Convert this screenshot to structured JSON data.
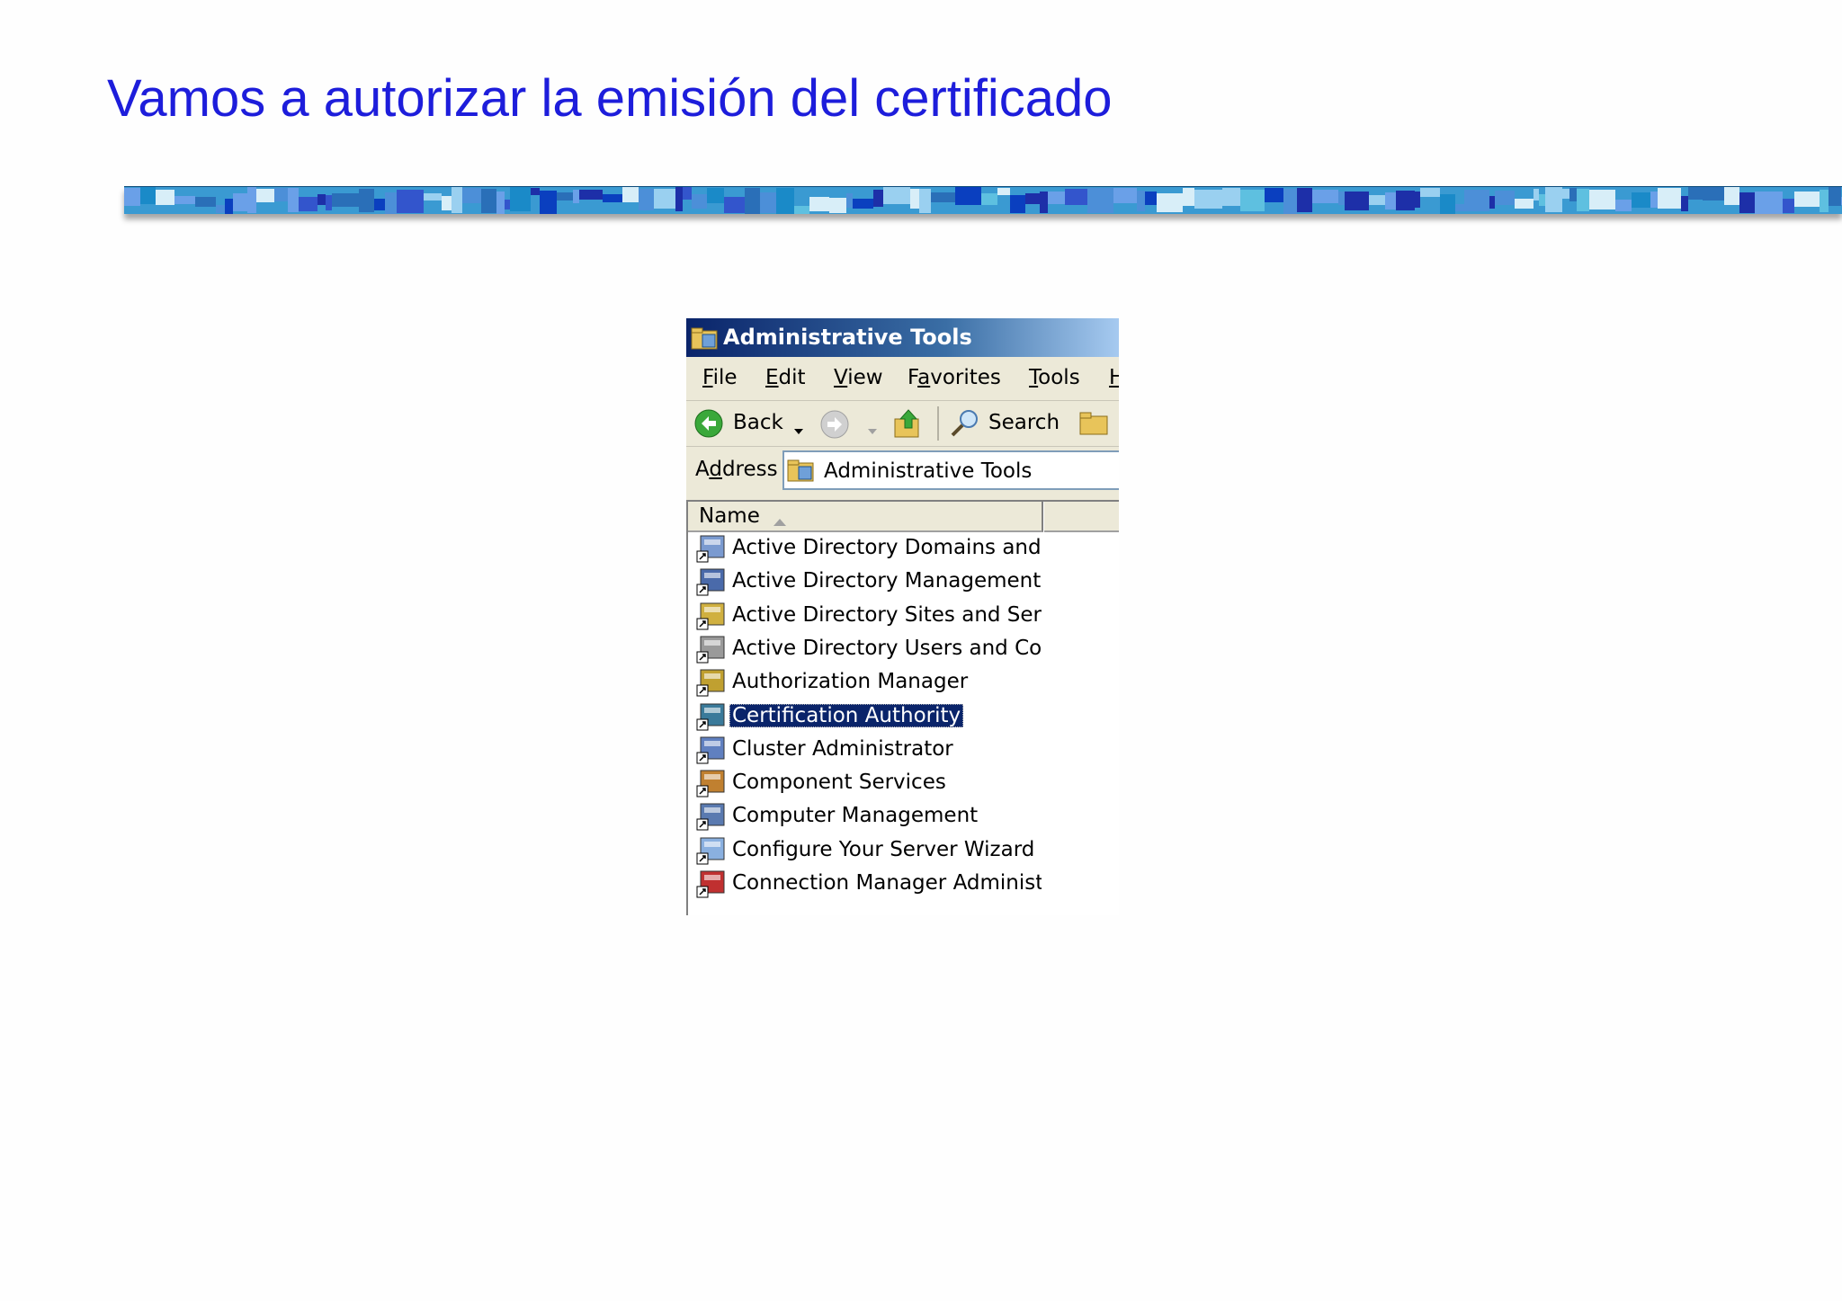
{
  "slide": {
    "title": "Vamos a autorizar la emisión del certificado"
  },
  "window": {
    "title": "Administrative Tools",
    "menu": [
      {
        "pre": "",
        "key": "F",
        "post": "ile"
      },
      {
        "pre": "",
        "key": "E",
        "post": "dit"
      },
      {
        "pre": "",
        "key": "V",
        "post": "iew"
      },
      {
        "pre": "F",
        "key": "a",
        "post": "vorites"
      },
      {
        "pre": "",
        "key": "T",
        "post": "ools"
      },
      {
        "pre": "",
        "key": "H",
        "post": ""
      }
    ],
    "toolbar": {
      "back": "Back",
      "search": "Search"
    },
    "address": {
      "label_pre": "A",
      "label_key": "d",
      "label_post": "dress",
      "value": "Administrative Tools"
    },
    "list": {
      "column": "Name",
      "items": [
        "Active Directory Domains and …",
        "Active Directory Management",
        "Active Directory Sites and Ser…",
        "Active Directory Users and Co…",
        "Authorization Manager",
        "Certification Authority",
        "Cluster Administrator",
        "Component Services",
        "Computer Management",
        "Configure Your Server Wizard",
        "Connection Manager Administ…"
      ],
      "selected": "Certification Authority"
    }
  },
  "colors": {
    "title_text": "#1d1ddb",
    "selection": "#0a246a",
    "titlebar_start": "#0a246a"
  },
  "icons": [
    "folder-tools-icon",
    "back-arrow-icon",
    "forward-arrow-icon",
    "up-folder-icon",
    "search-icon",
    "folders-icon",
    "sort-ascending-icon"
  ]
}
